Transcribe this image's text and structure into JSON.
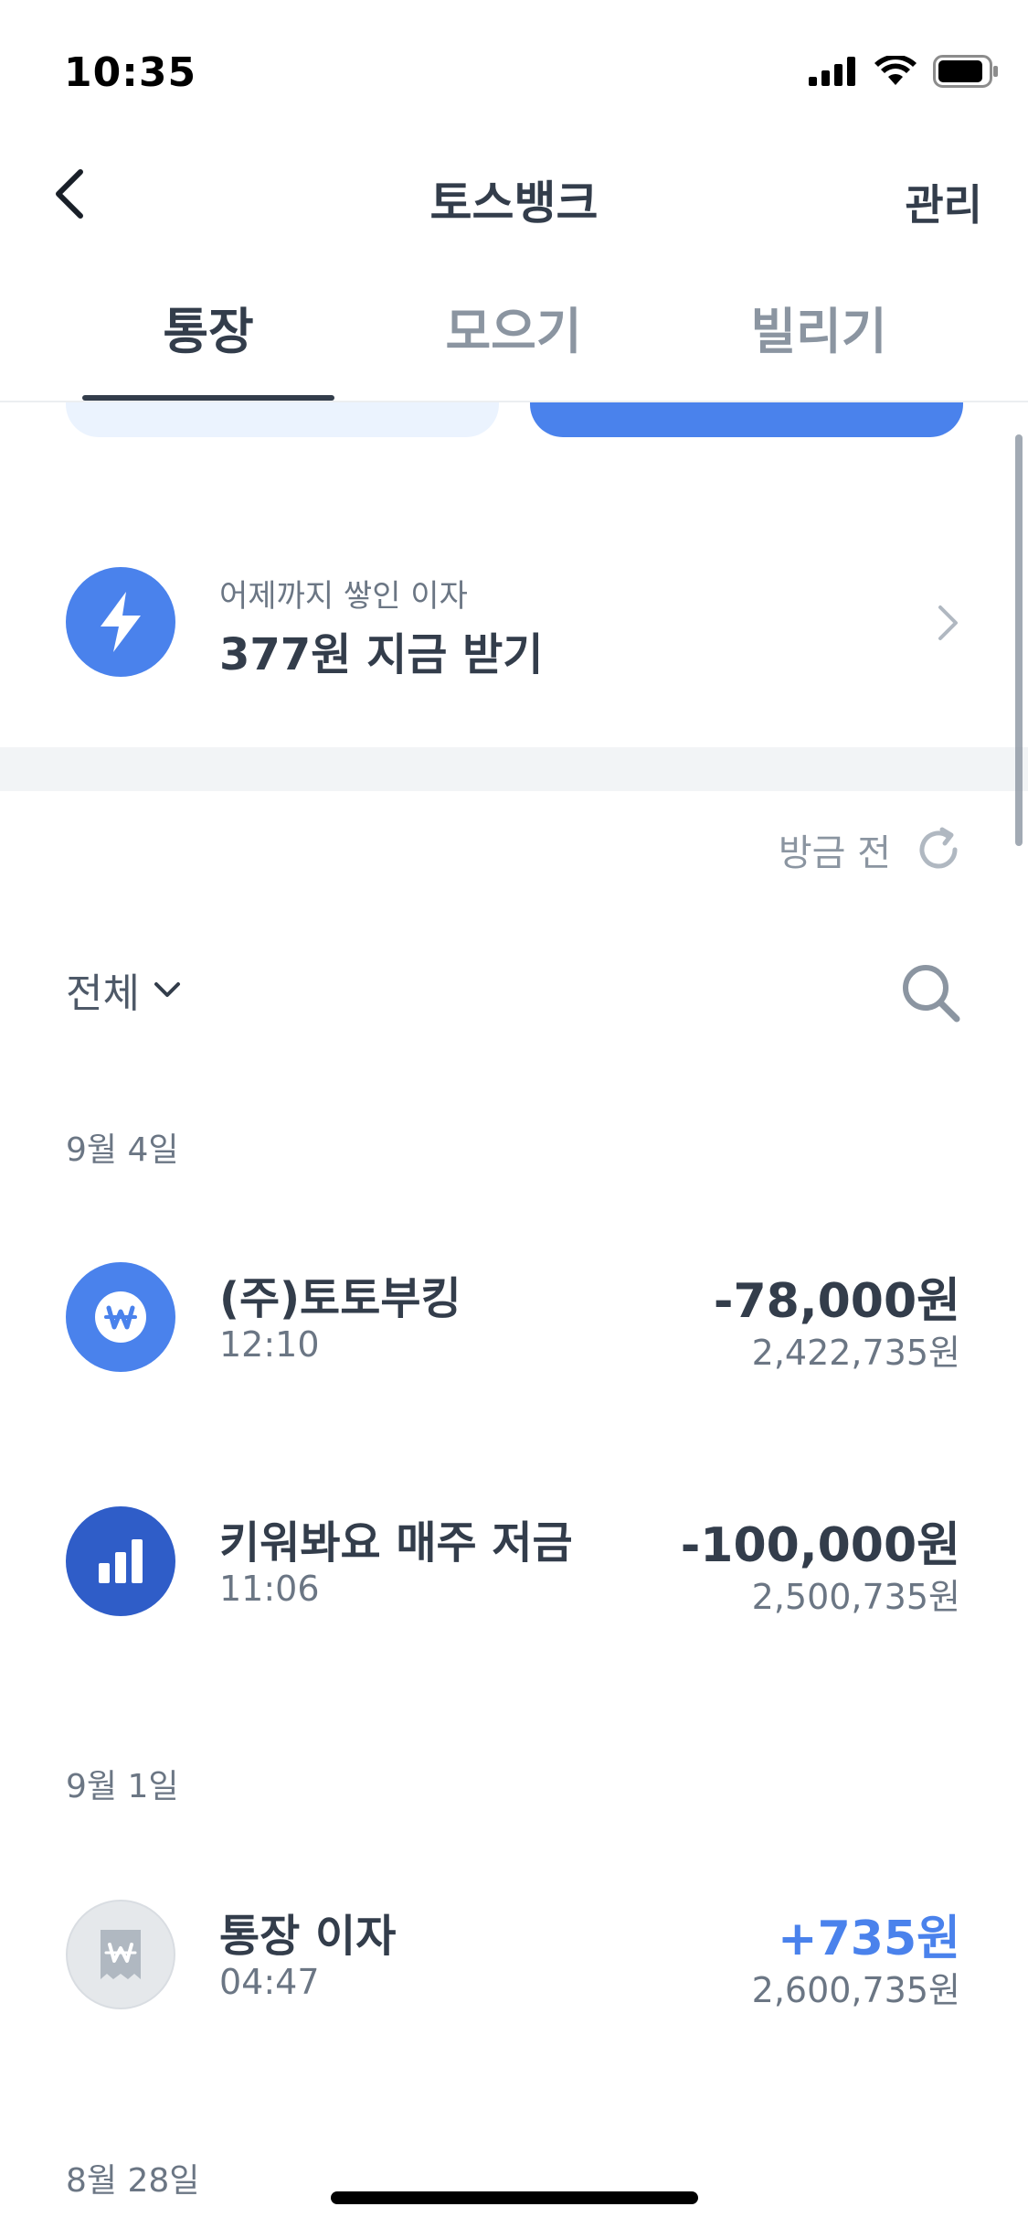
{
  "status_bar": {
    "time": "10:35"
  },
  "header": {
    "title": "토스뱅크",
    "manage_label": "관리"
  },
  "tabs": [
    {
      "label": "통장",
      "active": true
    },
    {
      "label": "모으기",
      "active": false
    },
    {
      "label": "빌리기",
      "active": false
    }
  ],
  "interest": {
    "subtitle": "어제까지 쌓인 이자",
    "title": "377원 지금 받기"
  },
  "refresh": {
    "label": "방금 전"
  },
  "filter": {
    "label": "전체"
  },
  "groups": [
    {
      "date": "9월 4일",
      "transactions": [
        {
          "name": "(주)토토부킹",
          "time": "12:10",
          "amount": "-78,000원",
          "balance": "2,422,735원",
          "icon": "won-coin-icon"
        },
        {
          "name": "키워봐요 매주 저금",
          "time": "11:06",
          "amount": "-100,000원",
          "balance": "2,500,735원",
          "icon": "bar-chart-icon"
        }
      ]
    },
    {
      "date": "9월 1일",
      "transactions": [
        {
          "name": "통장 이자",
          "time": "04:47",
          "amount": "+735원",
          "balance": "2,600,735원",
          "icon": "receipt-won-icon"
        }
      ]
    },
    {
      "date": "8월 28일",
      "transactions": []
    }
  ],
  "colors": {
    "accent": "#4a82ec",
    "accent_dark": "#2f5dc8",
    "text_primary": "#333d4b",
    "text_secondary": "#6b7684",
    "text_tertiary": "#8b95a1",
    "band": "#f2f4f6"
  }
}
